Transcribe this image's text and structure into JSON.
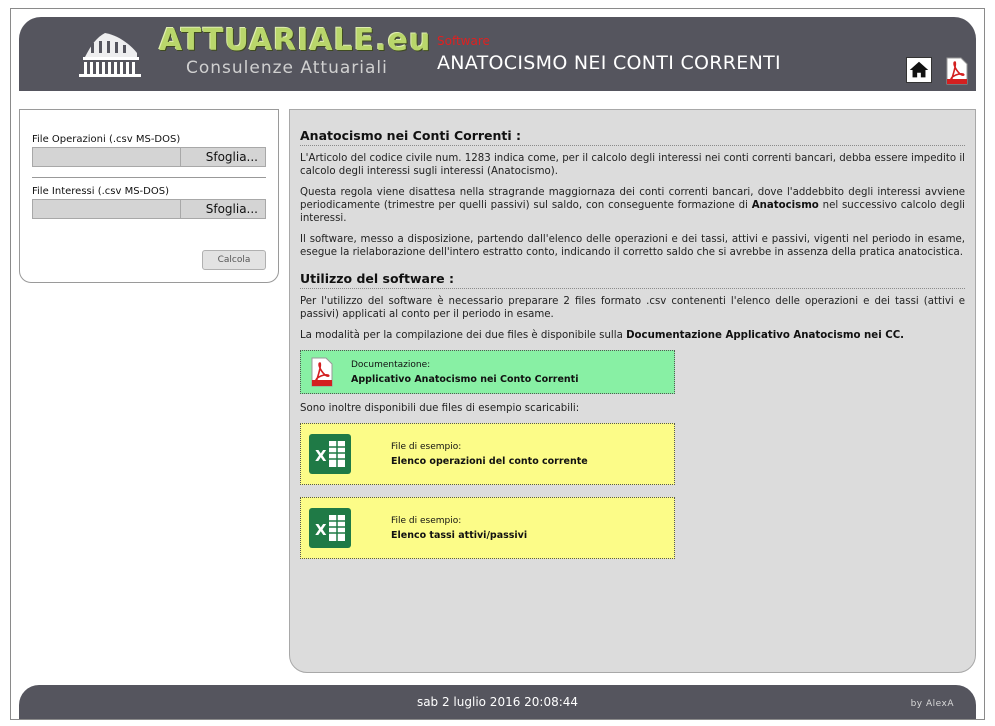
{
  "header": {
    "logo_title": "ATTUARIALE.eu",
    "logo_subtitle": "Consulenze Attuariali",
    "software_label": "Software",
    "title": "ANATOCISMO NEI CONTI CORRENTI",
    "home_icon": "home-icon",
    "pdf_icon": "pdf-icon"
  },
  "form": {
    "operations_label": "File Operazioni (.csv MS-DOS)",
    "interests_label": "File Interessi (.csv MS-DOS)",
    "browse_label": "Sfoglia...",
    "calc_label": "Calcola",
    "operations_value": "",
    "interests_value": ""
  },
  "content": {
    "section1_title": "Anatocismo nei Conti Correnti :",
    "p1": "L'Articolo del codice civile num. 1283 indica come, per il calcolo degli interessi nei conti correnti bancari, debba essere impedito il calcolo degli interessi sugli interessi (Anatocismo).",
    "p2_pre": "Questa regola viene disattesa nella stragrande maggiornaza dei conti correnti bancari, dove l'addebbito degli interessi avviene periodicamente (trimestre per quelli passivi) sul saldo, con conseguente formazione di ",
    "p2_bold": "Anatocismo",
    "p2_post": " nel successivo calcolo degli interessi.",
    "p3": "Il software, messo a disposizione, partendo dall'elenco delle operazioni e dei tassi, attivi e passivi, vigenti nel periodo in esame, esegue la rielaborazione dell'intero estratto conto, indicando il corretto saldo che si avrebbe in assenza della pratica anatocistica.",
    "section2_title": "Utilizzo del software :",
    "p4": "Per l'utilizzo del software è necessario preparare 2 files formato .csv contenenti l'elenco delle operazioni e dei tassi (attivi e passivi) applicati al conto per il periodo in esame.",
    "p5_pre": "La modalità per la compilazione dei due files è disponibile sulla ",
    "p5_bold": "Documentazione Applicativo Anatocismo nei CC.",
    "doc_box": {
      "line1": "Documentazione:",
      "line2": "Applicativo Anatocismo nei Conto Correnti"
    },
    "p6": "Sono inoltre disponibili due files di esempio scaricabili:",
    "example1": {
      "line1": "File di esempio:",
      "line2": "Elenco operazioni del conto corrente"
    },
    "example2": {
      "line1": "File di esempio:",
      "line2": "Elenco tassi attivi/passivi"
    }
  },
  "footer": {
    "date": "sab 2 luglio 2016 20:08:44",
    "by": "by AlexA"
  },
  "colors": {
    "header_bg": "#55555e",
    "logo_green": "#b9d66b",
    "software_red": "#e02020",
    "doc_box_green": "#88f0a4",
    "example_box_yellow": "#fcfc88",
    "content_bg": "#dcdcdc"
  }
}
